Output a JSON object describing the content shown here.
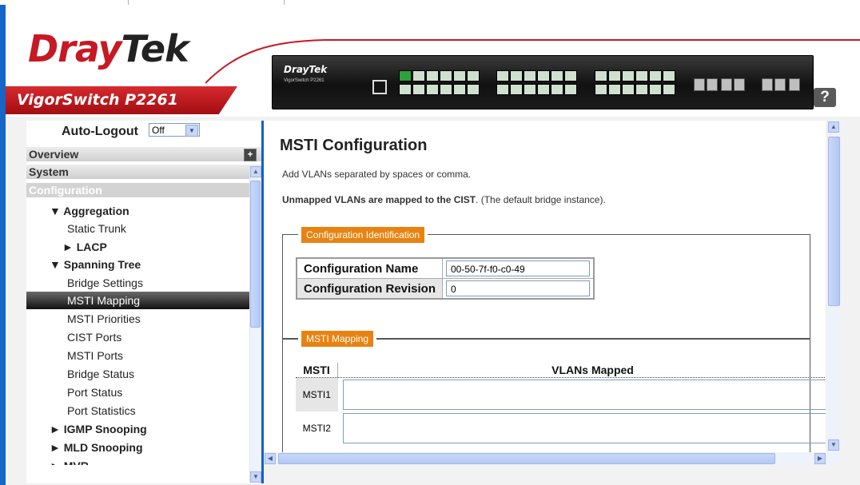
{
  "header": {
    "logo_part1": "Dray",
    "logo_part2": "Tek",
    "product_name": "VigorSwitch P2261",
    "device_brand": "DrayTek",
    "device_model": "VigorSwitch P2261",
    "help_label": "?"
  },
  "autologout": {
    "label": "Auto-Logout",
    "value": "Off"
  },
  "nav": {
    "headers": [
      "Overview",
      "System",
      "Configuration"
    ],
    "items": [
      {
        "label": "▼ Aggregation",
        "type": "grp"
      },
      {
        "label": "Static Trunk",
        "type": "sub"
      },
      {
        "label": "► LACP",
        "type": "sub2"
      },
      {
        "label": "▼ Spanning Tree",
        "type": "grp"
      },
      {
        "label": "Bridge Settings",
        "type": "sub"
      },
      {
        "label": "MSTI Mapping",
        "type": "sub",
        "selected": true
      },
      {
        "label": "MSTI Priorities",
        "type": "sub"
      },
      {
        "label": "CIST Ports",
        "type": "sub"
      },
      {
        "label": "MSTI Ports",
        "type": "sub"
      },
      {
        "label": "Bridge Status",
        "type": "sub"
      },
      {
        "label": "Port Status",
        "type": "sub"
      },
      {
        "label": "Port Statistics",
        "type": "sub"
      },
      {
        "label": "► IGMP Snooping",
        "type": "grp"
      },
      {
        "label": "► MLD Snooping",
        "type": "grp"
      },
      {
        "label": "► MVR",
        "type": "grp"
      }
    ]
  },
  "main": {
    "title": "MSTI Configuration",
    "hint1": "Add VLANs separated by spaces or comma.",
    "hint2_bold": "Unmapped VLANs are mapped to the CIST",
    "hint2_rest": ". (The default bridge instance).",
    "config_legend": "Configuration Identification",
    "config_name_label": "Configuration Name",
    "config_name_value": "00-50-7f-f0-c0-49",
    "config_revision_label": "Configuration Revision",
    "config_revision_value": "0",
    "mapping_legend": "MSTI Mapping",
    "col_msti": "MSTI",
    "col_vlans": "VLANs Mapped",
    "rows": [
      {
        "msti": "MSTI1",
        "vlans": ""
      },
      {
        "msti": "MSTI2",
        "vlans": ""
      }
    ]
  }
}
